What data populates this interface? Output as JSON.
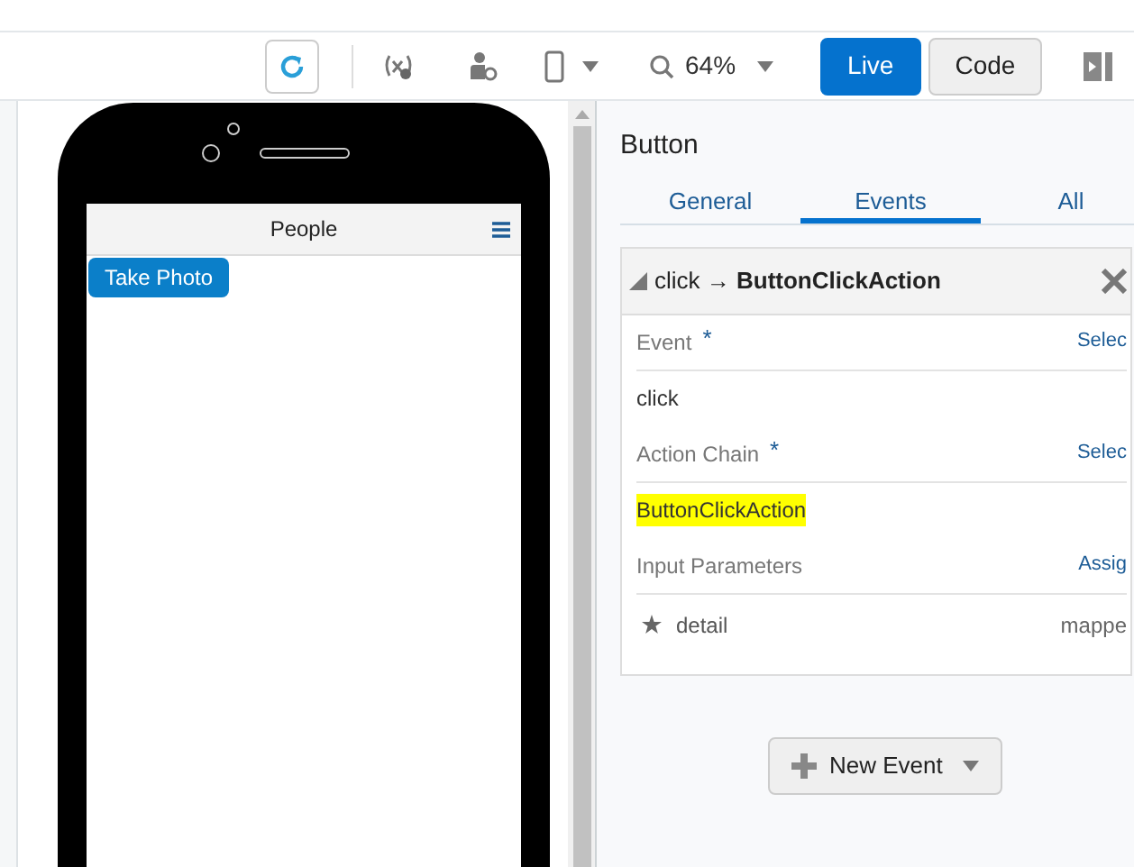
{
  "toolbar": {
    "zoom": "64%",
    "modes": [
      {
        "label": "Live",
        "selected": true
      },
      {
        "label": "Code",
        "selected": false
      }
    ]
  },
  "phone": {
    "title": "People",
    "button": "Take Photo"
  },
  "panel": {
    "title": "Button",
    "tabs": [
      {
        "label": "General",
        "selected": false
      },
      {
        "label": "Events",
        "selected": true
      },
      {
        "label": "All",
        "selected": false
      }
    ],
    "event_card": {
      "header": "click → **ButtonClickAction**",
      "expanded": true,
      "rows": [
        {
          "kind": "label",
          "text": "Event",
          "marker": "*",
          "link": "Selec"
        },
        {
          "kind": "value",
          "text": "click",
          "highlighted": false
        },
        {
          "kind": "label",
          "text": "Action Chain",
          "marker": "*",
          "link": "Selec"
        },
        {
          "kind": "value",
          "text": "ButtonClickAction",
          "highlighted": true
        },
        {
          "kind": "label",
          "text": "Input Parameters",
          "link": "Assig"
        },
        {
          "kind": "param",
          "text": "detail",
          "value": "mappe"
        }
      ]
    },
    "new_event": "New Event"
  }
}
